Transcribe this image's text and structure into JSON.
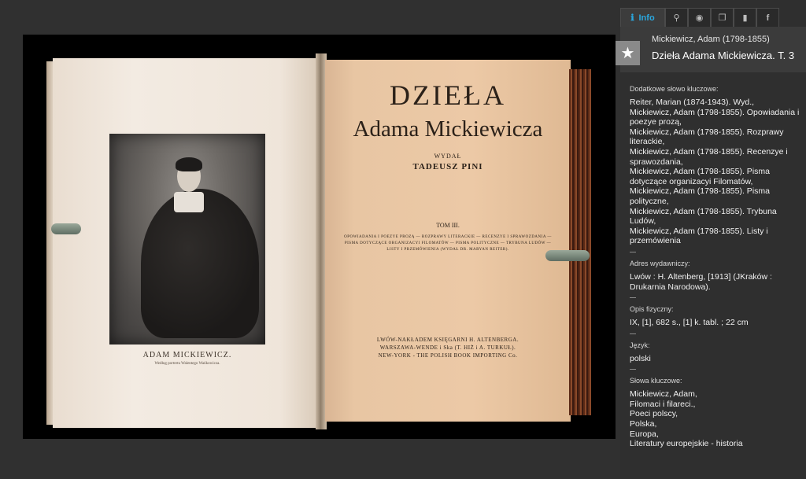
{
  "tabs": [
    {
      "icon": "info-icon",
      "label": "Info",
      "glyph": "ℹ"
    },
    {
      "icon": "search-icon",
      "label": "",
      "glyph": "⚲"
    },
    {
      "icon": "eye-icon",
      "label": "",
      "glyph": "◉"
    },
    {
      "icon": "copy-icon",
      "label": "",
      "glyph": "❐"
    },
    {
      "icon": "bookmark-icon",
      "label": "",
      "glyph": "▮"
    },
    {
      "icon": "facebook-icon",
      "label": "",
      "glyph": "f"
    }
  ],
  "record": {
    "author": "Mickiewicz, Adam (1798-1855)",
    "title": "Dzieła Adama Mickiewicza. T. 3",
    "favorite_glyph": "★"
  },
  "book": {
    "left_page": {
      "caption_name": "ADAM MICKIEWICZ.",
      "caption_sub": "Według portretu Walentego Wańkowicza."
    },
    "right_page": {
      "title": "DZIEŁA",
      "author": "Adama Mickiewicza",
      "editor_label": "WYDAŁ",
      "editor": "TADEUSZ PINI",
      "tom": "TOM III.",
      "contents": "OPOWIADANIA I POEZYE PROZĄ — ROZPRAWY LITERACKIE — RECENZYE I SPRAWOZDANIA — PISMA DOTYCZĄCE ORGANIZACYI FILOMATÓW — PISMA POLITYCZNE — TRYBUNA LUDÓW — LISTY I PRZEMÓWIENIA (WYDAŁ DR. MARYAN REITER).",
      "publisher_1": "LWÓW-NAKŁADEM KSIĘGARNI H. ALTENBERGA.",
      "publisher_2": "WARSZAWA-WENDE i Ska (T. HIŻ i A. TURKUŁ).",
      "publisher_3": "NEW-YORK - THE POLISH BOOK IMPORTING Co."
    }
  },
  "metadata": {
    "keywords_add": {
      "label": "Dodatkowe słowo kluczowe:",
      "values": [
        "Reiter, Marian (1874-1943). Wyd.,",
        "Mickiewicz, Adam (1798-1855). Opowiadania i poezye prozą,",
        "Mickiewicz, Adam (1798-1855). Rozprawy literackie,",
        "Mickiewicz, Adam (1798-1855). Recenzye i sprawozdania,",
        "Mickiewicz, Adam (1798-1855). Pisma dotyczące organizacyi Filomatów,",
        "Mickiewicz, Adam (1798-1855). Pisma polityczne,",
        "Mickiewicz, Adam (1798-1855). Trybuna Ludów,",
        "Mickiewicz, Adam (1798-1855). Listy i przemówienia"
      ]
    },
    "publisher": {
      "label": "Adres wydawniczy:",
      "value": "Lwów : H. Altenberg, [1913] (JKraków : Drukarnia Narodowa)."
    },
    "physical": {
      "label": "Opis fizyczny:",
      "value": "IX, [1], 682 s., [1] k. tabl. ; 22 cm"
    },
    "language": {
      "label": "Język:",
      "value": "polski"
    },
    "keywords": {
      "label": "Słowa kluczowe:",
      "values": [
        "Mickiewicz, Adam,",
        "Filomaci i filareci.,",
        "Poeci polscy,",
        "Polska,",
        "Europa,",
        "Literatury europejskie - historia"
      ]
    }
  }
}
